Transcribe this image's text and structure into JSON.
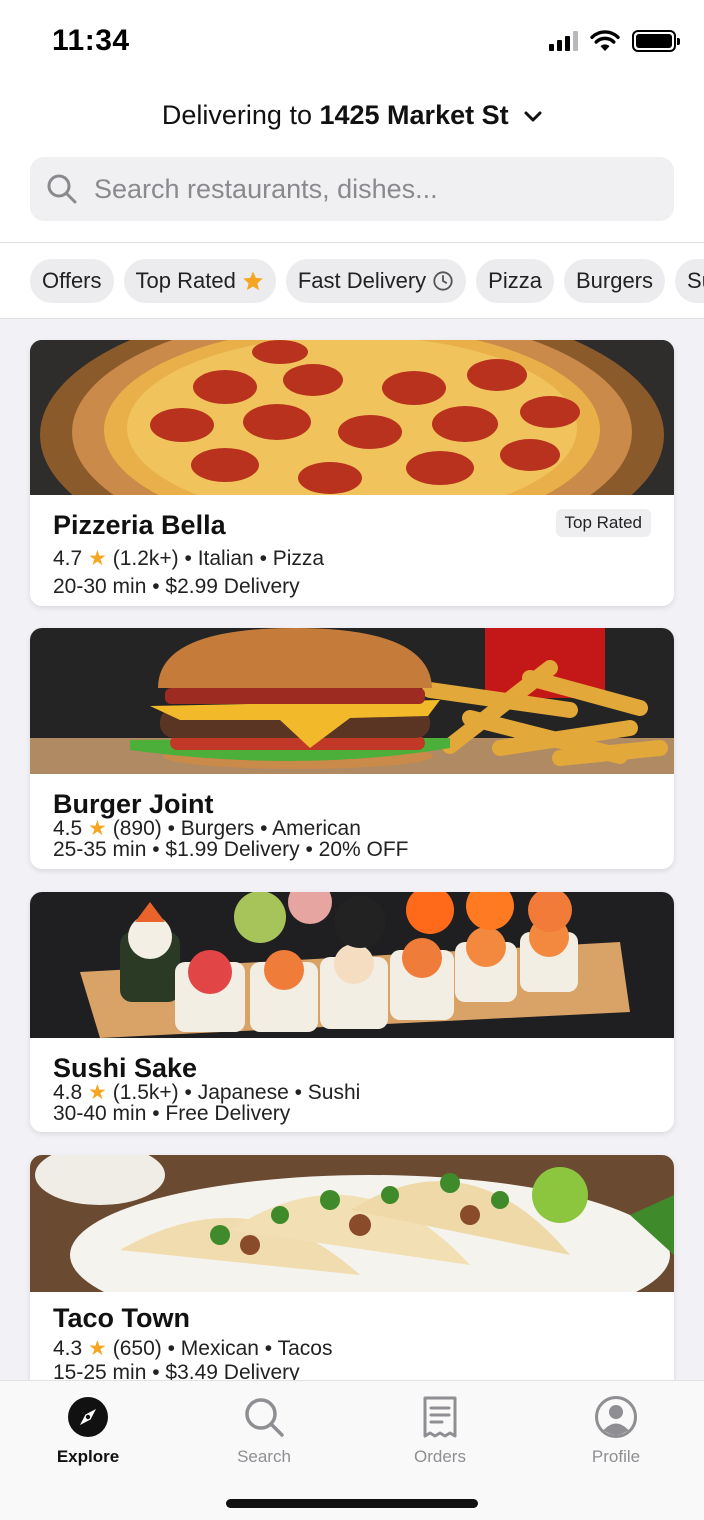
{
  "status_bar": {
    "time": "11:34"
  },
  "header": {
    "delivering_prefix": "Delivering to",
    "address": "1425 Market St"
  },
  "search": {
    "placeholder": "Search restaurants, dishes..."
  },
  "filters": [
    {
      "label": "Offers",
      "icon": ""
    },
    {
      "label": "Top Rated",
      "icon": "star-icon"
    },
    {
      "label": "Fast Delivery",
      "icon": "clock-icon"
    },
    {
      "label": "Pizza",
      "icon": ""
    },
    {
      "label": "Burgers",
      "icon": ""
    },
    {
      "label": "Sushi",
      "icon": ""
    }
  ],
  "restaurants": [
    {
      "name": "Pizzeria Bella",
      "rating": "4.7",
      "reviews": "(1.2k+)",
      "cuisine": "• Italian • Pizza",
      "delivery_line": "20-30 min • $2.99 Delivery",
      "badge": "Top Rated",
      "image": "pizza-photo"
    },
    {
      "name": "Burger Joint",
      "rating": "4.5",
      "reviews": "(890)",
      "cuisine": "• Burgers • American",
      "delivery_line": "25-35 min • $1.99 Delivery • 20% OFF",
      "badge": "",
      "image": "burger-photo"
    },
    {
      "name": "Sushi Sake",
      "rating": "4.8",
      "reviews": "(1.5k+)",
      "cuisine": "• Japanese • Sushi",
      "delivery_line": "30-40 min • Free Delivery",
      "badge": "",
      "image": "sushi-photo"
    },
    {
      "name": "Taco Town",
      "rating": "4.3",
      "reviews": "(650)",
      "cuisine": "• Mexican • Tacos",
      "delivery_line": "15-25 min • $3.49 Delivery",
      "badge": "",
      "image": "tacos-photo"
    }
  ],
  "tabs": [
    {
      "label": "Explore",
      "icon": "compass-icon",
      "active": true
    },
    {
      "label": "Search",
      "icon": "search-icon",
      "active": false
    },
    {
      "label": "Orders",
      "icon": "receipt-icon",
      "active": false
    },
    {
      "label": "Profile",
      "icon": "profile-icon",
      "active": false
    }
  ],
  "colors": {
    "star": "#f5a623",
    "accent": "#111111",
    "chip_bg": "#ececef",
    "feed_bg": "#f2f2f6"
  }
}
